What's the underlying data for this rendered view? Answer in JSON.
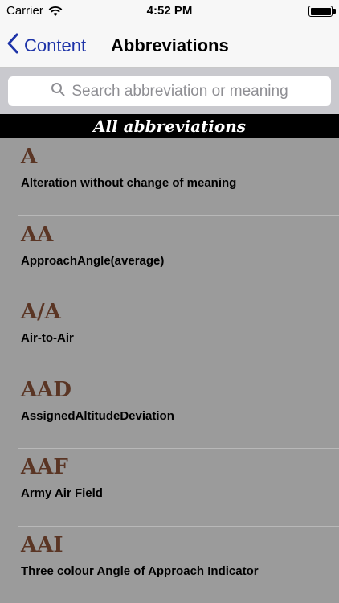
{
  "status": {
    "carrier": "Carrier",
    "time": "4:52 PM"
  },
  "nav": {
    "back_label": "Content",
    "title": "Abbreviations"
  },
  "search": {
    "placeholder": "Search abbreviation or meaning"
  },
  "section": {
    "title": "All abbreviations"
  },
  "items": [
    {
      "abbr": "A",
      "meaning": "Alteration without change of meaning"
    },
    {
      "abbr": "AA",
      "meaning": "ApproachAngle(average)"
    },
    {
      "abbr": "A/A",
      "meaning": "Air-to-Air"
    },
    {
      "abbr": "AAD",
      "meaning": "AssignedAltitudeDeviation"
    },
    {
      "abbr": "AAF",
      "meaning": "Army Air Field"
    },
    {
      "abbr": "AAI",
      "meaning": "Three colour Angle of Approach Indicator"
    }
  ],
  "colors": {
    "accent": "#1d33a8",
    "abbr": "#5a3524",
    "background": "#9b9b9b"
  }
}
